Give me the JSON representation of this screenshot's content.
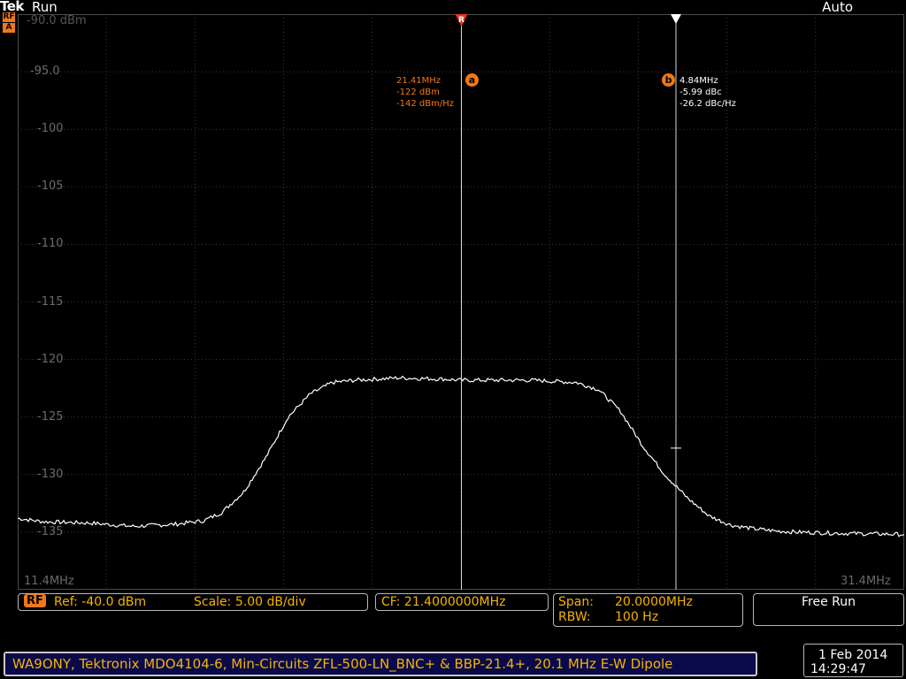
{
  "header": {
    "brand": "Tek",
    "run_status": "Run",
    "trigger_mode": "Auto",
    "side_tag_top": "RF",
    "side_tag_bottom": "A"
  },
  "display": {
    "ref_level_label": "-90.0 dBm",
    "y_ticks": [
      "-95.0",
      "-100",
      "-105",
      "-110",
      "-115",
      "-120",
      "-125",
      "-130",
      "-135"
    ],
    "start_freq": "11.4MHz",
    "stop_freq": "31.4MHz",
    "trace_color": "#ffffff",
    "marker_color": "#f07818"
  },
  "markers": {
    "a": {
      "badge": "a",
      "top_symbol": "R",
      "lines": [
        "21.41MHz",
        "-122 dBm",
        "-142 dBm/Hz"
      ]
    },
    "b": {
      "badge": "b",
      "lines": [
        "4.84MHz",
        "-5.99 dBc",
        "-26.2 dBc/Hz"
      ]
    }
  },
  "readouts": {
    "rf_tag": "RF",
    "ref": "Ref: -40.0 dBm",
    "scale": "Scale: 5.00 dB/div",
    "cf": "CF:  21.4000000MHz",
    "span_label": "Span:",
    "span_value": "20.0000MHz",
    "rbw_label": "RBW:",
    "rbw_value": "100 Hz",
    "acquire_mode": "Free Run"
  },
  "status_bar": {
    "text": "WA9ONY, Tektronix MDO4104-6, Min-Circuits ZFL-500-LN_BNC+ & BBP-21.4+, 20.1 MHz E-W Dipole"
  },
  "datetime": {
    "date": "1 Feb  2014",
    "time": "14:29:47"
  },
  "chart_data": {
    "type": "line",
    "title": "",
    "xlabel": "",
    "ylabel": "",
    "xlim": [
      11.4,
      31.4
    ],
    "ylim": [
      -140,
      -90
    ],
    "x_unit": "MHz",
    "y_unit": "dBm",
    "series": [
      {
        "x": [
          11.4,
          12.0,
          13.0,
          14.0,
          15.0,
          15.6,
          16.0,
          16.5,
          17.0,
          17.5,
          18.0,
          18.5,
          19.0,
          20.0,
          21.0,
          21.4,
          22.0,
          23.0,
          24.0,
          24.5,
          25.0,
          25.5,
          26.0,
          26.5,
          27.0,
          27.5,
          28.0,
          28.5,
          29.0,
          30.0,
          31.4
        ],
        "values": [
          -133.8,
          -134.1,
          -134.2,
          -134.5,
          -134.3,
          -134.0,
          -133.3,
          -131.5,
          -128.5,
          -125.0,
          -123.0,
          -122.0,
          -121.8,
          -121.6,
          -121.7,
          -121.8,
          -121.8,
          -121.8,
          -122.0,
          -122.6,
          -124.5,
          -127.5,
          -130.0,
          -132.0,
          -133.6,
          -134.4,
          -134.7,
          -134.9,
          -135.0,
          -135.1,
          -135.2
        ]
      }
    ]
  }
}
